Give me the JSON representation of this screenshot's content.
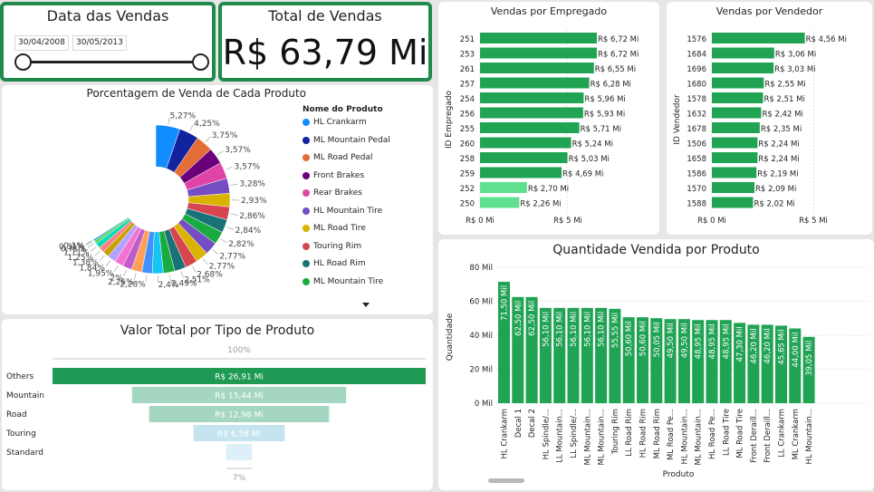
{
  "date_slicer": {
    "title": "Data das Vendas",
    "start_date": "30/04/2008",
    "end_date": "30/05/2013"
  },
  "total_card": {
    "title": "Total de Vendas",
    "value": "R$ 63,79 Mi"
  },
  "donut": {
    "title": "Porcentagem de Venda de Cada Produto",
    "legend_title": "Nome do Produto",
    "legend": [
      {
        "label": "HL Crankarm",
        "color": "#118DFF"
      },
      {
        "label": "ML Mountain Pedal",
        "color": "#12239E"
      },
      {
        "label": "ML Road Pedal",
        "color": "#E66C37"
      },
      {
        "label": "Front Brakes",
        "color": "#6B007B"
      },
      {
        "label": "Rear Brakes",
        "color": "#E044A7"
      },
      {
        "label": "HL Mountain Tire",
        "color": "#744EC2"
      },
      {
        "label": "ML Road Tire",
        "color": "#D9B300"
      },
      {
        "label": "Touring Rim",
        "color": "#D64550"
      },
      {
        "label": "HL Road Rim",
        "color": "#197278"
      },
      {
        "label": "ML Mountain Tire",
        "color": "#1AAB40"
      }
    ],
    "labels_right": [
      "5,27%",
      "4,25%",
      "3,75%",
      "3,57%",
      "3,57%",
      "3,28%",
      "2,93%",
      "2,86%",
      "2,84%",
      "2,82%",
      "2,77%",
      "2,77%",
      "2,68%"
    ],
    "labels_bottom_left": [
      "2,51%",
      "2,49%",
      "2,4%",
      "2,28%",
      "2,26%",
      "2%",
      "1,95%",
      "1,84%",
      "1,38%",
      "1,25%",
      "1,11%",
      "0,71%",
      "0,31%",
      "0,1%"
    ]
  },
  "funnel": {
    "title": "Valor Total por Tipo de Produto",
    "top_label": "100%",
    "bottom_label": "7%",
    "rows": [
      {
        "category": "Others",
        "label": "R$ 26,91 Mi",
        "value": 26.91,
        "color": "#1f9a55"
      },
      {
        "category": "Mountain",
        "label": "R$ 15,44 Mi",
        "value": 15.44,
        "color": "#a4d6c2"
      },
      {
        "category": "Road",
        "label": "R$ 12,98 Mi",
        "value": 12.98,
        "color": "#a4d6c2"
      },
      {
        "category": "Touring",
        "label": "R$ 6,58 Mi",
        "value": 6.58,
        "color": "#c6e4ef"
      },
      {
        "category": "Standard",
        "label": "",
        "value": 1.88,
        "color": "#ddeff8"
      }
    ]
  },
  "emp_chart": {
    "title": "Vendas por Empregado",
    "ylabel": "ID Empregado",
    "x_ticks": [
      "R$ 0 Mi",
      "R$ 5 Mi"
    ],
    "bars": [
      {
        "id": "251",
        "label": "R$ 6,72 Mi",
        "value": 6.72
      },
      {
        "id": "253",
        "label": "R$ 6,72 Mi",
        "value": 6.72
      },
      {
        "id": "261",
        "label": "R$ 6,55 Mi",
        "value": 6.55
      },
      {
        "id": "257",
        "label": "R$ 6,28 Mi",
        "value": 6.28
      },
      {
        "id": "254",
        "label": "R$ 5,96 Mi",
        "value": 5.96
      },
      {
        "id": "256",
        "label": "R$ 5,93 Mi",
        "value": 5.93
      },
      {
        "id": "255",
        "label": "R$ 5,71 Mi",
        "value": 5.71
      },
      {
        "id": "260",
        "label": "R$ 5,24 Mi",
        "value": 5.24
      },
      {
        "id": "258",
        "label": "R$ 5,03 Mi",
        "value": 5.03
      },
      {
        "id": "259",
        "label": "R$ 4,69 Mi",
        "value": 4.69
      },
      {
        "id": "252",
        "label": "R$ 2,70 Mi",
        "value": 2.7
      },
      {
        "id": "250",
        "label": "R$ 2,26 Mi",
        "value": 2.26
      }
    ]
  },
  "vend_chart": {
    "title": "Vendas por Vendedor",
    "ylabel": "ID Vendedor",
    "x_ticks": [
      "R$ 0 Mi",
      "R$ 5 Mi"
    ],
    "bars": [
      {
        "id": "1576",
        "label": "R$ 4,56 Mi",
        "value": 4.56
      },
      {
        "id": "1684",
        "label": "R$ 3,06 Mi",
        "value": 3.06
      },
      {
        "id": "1696",
        "label": "R$ 3,03 Mi",
        "value": 3.03
      },
      {
        "id": "1680",
        "label": "R$ 2,55 Mi",
        "value": 2.55
      },
      {
        "id": "1578",
        "label": "R$ 2,51 Mi",
        "value": 2.51
      },
      {
        "id": "1632",
        "label": "R$ 2,42 Mi",
        "value": 2.42
      },
      {
        "id": "1678",
        "label": "R$ 2,35 Mi",
        "value": 2.35
      },
      {
        "id": "1506",
        "label": "R$ 2,24 Mi",
        "value": 2.24
      },
      {
        "id": "1658",
        "label": "R$ 2,24 Mi",
        "value": 2.24
      },
      {
        "id": "1586",
        "label": "R$ 2,19 Mi",
        "value": 2.19
      },
      {
        "id": "1570",
        "label": "R$ 2,09 Mi",
        "value": 2.09
      },
      {
        "id": "1588",
        "label": "R$ 2,02 Mi",
        "value": 2.02
      }
    ]
  },
  "chart_data": {
    "type": "bar",
    "title": "Quantidade Vendida por Produto",
    "xlabel": "Produto",
    "ylabel": "Quantidade",
    "y_ticks": [
      "0 Mil",
      "20 Mil",
      "40 Mil",
      "60 Mil",
      "80 Mil"
    ],
    "ylim": [
      0,
      80
    ],
    "categories": [
      "HL Crankarm",
      "Decal 1",
      "Decal 2",
      "HL Spindle/...",
      "LL Mountain...",
      "LL Spindle/...",
      "ML Mountain...",
      "ML Mountain...",
      "Touring Rim",
      "LL Road Rim",
      "HL Road Rim",
      "ML Road Rim",
      "ML Road Pe...",
      "HL Mountain...",
      "ML Mountain...",
      "HL Road Pe...",
      "LL Road Tire",
      "ML Road Tire",
      "Front Deraill...",
      "Front Deraill...",
      "LL Crankarm",
      "ML Crankarm",
      "HL Mountain..."
    ],
    "values": [
      71.5,
      62.5,
      62.5,
      56.1,
      56.1,
      56.1,
      56.1,
      56.1,
      55.55,
      50.6,
      50.6,
      50.05,
      49.5,
      49.5,
      48.95,
      48.95,
      48.95,
      47.3,
      46.2,
      46.2,
      45.65,
      44.0,
      39.05
    ],
    "value_labels": [
      "71,50 Mil",
      "62,50 Mil",
      "62,50 Mil",
      "56,10 Mil",
      "56,10 Mil",
      "56,10 Mil",
      "56,10 Mil",
      "56,10 Mil",
      "55,55 Mil",
      "50,60 Mil",
      "50,60 Mil",
      "50,05 Mil",
      "49,50 Mil",
      "49,50 Mil",
      "48,95 Mil",
      "48,95 Mil",
      "48,95 Mil",
      "47,30 Mil",
      "46,20 Mil",
      "46,20 Mil",
      "45,65 Mil",
      "44,00 Mil",
      "39,05 Mil"
    ]
  }
}
